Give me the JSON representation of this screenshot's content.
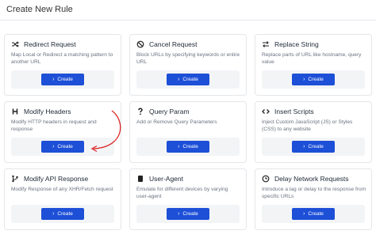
{
  "dialog": {
    "title": "Create New Rule"
  },
  "accent": "#1d4fd7",
  "annotation_color": "#dc2626",
  "cards": [
    {
      "title": "Redirect Request",
      "icon": "shuffle-icon",
      "description": "Map Local or Redirect a matching pattern to another URL",
      "button_label": "Create"
    },
    {
      "title": "Cancel Request",
      "icon": "block-icon",
      "description": "Block URLs by specifying keywords or entire URL",
      "button_label": "Create"
    },
    {
      "title": "Replace String",
      "icon": "swap-arrows-icon",
      "description": "Replace parts of URL like hostname, query value",
      "button_label": "Create"
    },
    {
      "title": "Modify Headers",
      "icon": "heading-icon",
      "description": "Modify HTTP headers in request and response",
      "button_label": "Create"
    },
    {
      "title": "Query Param",
      "icon": "question-mark-icon",
      "description": "Add or Remove Query Parameters",
      "button_label": "Create"
    },
    {
      "title": "Insert Scripts",
      "icon": "code-icon",
      "description": "Inject Custom JavaScript (JS) or Styles (CSS) to any website",
      "button_label": "Create"
    },
    {
      "title": "Modify API Response",
      "icon": "branch-icon",
      "description": "Modify Response of any XHR/Fetch request",
      "button_label": "Create"
    },
    {
      "title": "User-Agent",
      "icon": "device-icon",
      "description": "Emulate for different devices by varying user-agent",
      "button_label": "Create"
    },
    {
      "title": "Delay Network Requests",
      "icon": "clock-icon",
      "description": "Introduce a lag or delay to the response from specific URLs",
      "button_label": "Create"
    }
  ]
}
